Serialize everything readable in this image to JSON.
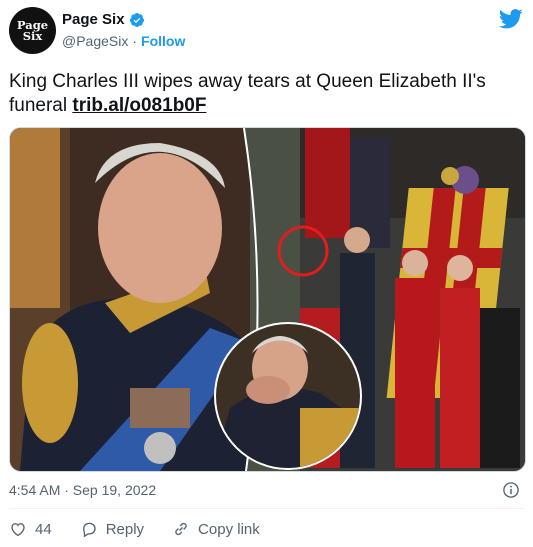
{
  "account": {
    "avatar_line1": "Page",
    "avatar_line2": "Six",
    "display_name": "Page Six",
    "handle": "@PageSix",
    "separator": "·",
    "follow_label": "Follow"
  },
  "tweet": {
    "text": "King Charles III wipes away tears at Queen Elizabeth II's funeral ",
    "link": "trib.al/o081b0F",
    "timestamp": "4:54 AM · Sep 19, 2022"
  },
  "actions": {
    "like_count": "44",
    "reply_label": "Reply",
    "copy_link_label": "Copy link"
  },
  "icons": [
    "verified-badge-icon",
    "twitter-bird-icon",
    "info-icon",
    "heart-icon",
    "reply-icon",
    "link-icon"
  ],
  "colors": {
    "brand_blue": "#1d9bf0",
    "text": "#0f1419",
    "muted": "#536471"
  }
}
